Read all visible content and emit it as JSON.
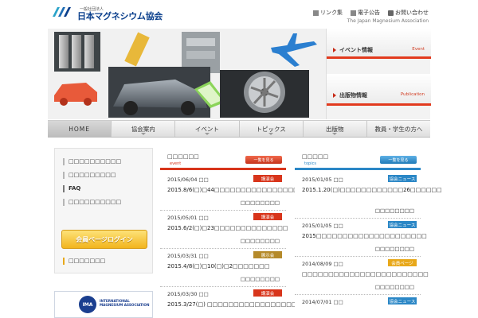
{
  "header": {
    "org_small": "一般社団法人",
    "org_name": "日本マグネシウム協会",
    "english_name": "The Japan Magnesium Association",
    "links": [
      "リンク集",
      "電子公告",
      "お問い合わせ"
    ]
  },
  "side_menu": [
    {
      "label": "イベント情報",
      "en": "Event"
    },
    {
      "label": "出版物情報",
      "en": "Publication"
    }
  ],
  "nav": [
    "HOME",
    "協会案内",
    "イベント",
    "トピックス",
    "出版物",
    "教員・学生の方へ"
  ],
  "left_menu": {
    "items": [
      "□□□□□□□□□□",
      "□□□□□□□□□",
      "FAQ",
      "□□□□□□□□□□"
    ],
    "login": "会員ページログイン",
    "member_item": "□□□□□□□",
    "ima": "INTERNATIONAL MAGNESIUM ASSOCIATION",
    "ima_mark": "IMA"
  },
  "event_col": {
    "title": "□□□□□□",
    "sub": "event",
    "button": "一覧を見る",
    "entries": [
      {
        "date": "2015/06/04 □□",
        "tag": "講演会",
        "title": "2015.8/6(□)□44□□□□□□□□□□□□□□□□□□",
        "place": "□□□□□□□□"
      },
      {
        "date": "2015/05/01 □□",
        "tag": "講演会",
        "title": "2015.6/2(□)□23□□□□□□□□□□□□□□",
        "place": "□□□□□□□□"
      },
      {
        "date": "2015/03/31 □□",
        "tag": "展示会",
        "title": "2015.4/8(□)□10(□)□2□□□□□□□",
        "place": "□□□□□□□□"
      },
      {
        "date": "2015/03/30 □□",
        "tag": "講演会",
        "title": "2015.3/27(□) □□□□□□□□□□□□□□□□□□",
        "place": ""
      }
    ]
  },
  "topics_col": {
    "title": "□□□□□",
    "sub": "topics",
    "button": "一覧を見る",
    "entries": [
      {
        "date": "2015/01/05 □□",
        "tag": "協会ニュース",
        "title": "2015.1.20(□)□□□□□□□□□□□□26□□□□□□",
        "place": "□□□□□□□□"
      },
      {
        "date": "2015/01/05 □□",
        "tag": "協会ニュース",
        "title": "2015□□□□□□□□□□□□□□□□□□□□□",
        "place": "□□□□□□□□"
      },
      {
        "date": "2014/08/09 □□",
        "tag": "会員ページ",
        "title": "□□□□□□□□□□□□□□□□□□□□□□□□",
        "place": "□□□□□□□□"
      },
      {
        "date": "2014/07/01 □□",
        "tag": "協会ニュース",
        "title": "",
        "place": ""
      }
    ]
  },
  "colors": {
    "brand_blue": "#0a3f8c",
    "accent_red": "#e23a1e",
    "topics_blue": "#2b87c6",
    "tag_lecture": "#d8351b",
    "tag_exhibit": "#b58a2a",
    "tag_news": "#2b87c6",
    "tag_member": "#e8a81a"
  }
}
